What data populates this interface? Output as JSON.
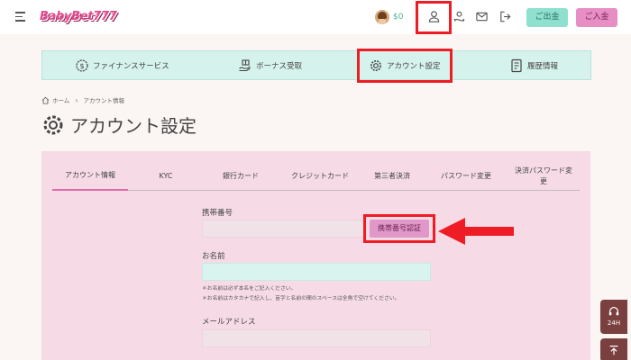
{
  "header": {
    "logo_text": "BabyBet777",
    "balance": "$0",
    "withdraw_label": "ご出金",
    "deposit_label": "ご入金"
  },
  "nav": {
    "items": [
      {
        "label": "ファイナンスサービス",
        "icon": "dollar-gear-icon"
      },
      {
        "label": "ボーナス受取",
        "icon": "gift-hand-icon"
      },
      {
        "label": "アカウント設定",
        "icon": "gear-icon"
      },
      {
        "label": "履歴情報",
        "icon": "document-icon"
      }
    ]
  },
  "breadcrumb": {
    "home": "ホーム",
    "current": "アカウント情報"
  },
  "page": {
    "title": "アカウント設定"
  },
  "tabs": [
    {
      "label": "アカウント情報",
      "active": true
    },
    {
      "label": "KYC"
    },
    {
      "label": "銀行カード"
    },
    {
      "label": "クレジットカード"
    },
    {
      "label": "第三者決済"
    },
    {
      "label": "パスワード変更"
    },
    {
      "label": "決済パスワード変更"
    }
  ],
  "form": {
    "phone_label": "携帯番号",
    "phone_value": "",
    "phone_verify_button": "携帯番号認証",
    "name_label": "お名前",
    "name_value": "",
    "name_note_1": "＊お名前は必ず本名をご記入ください。",
    "name_note_2": "＊お名前はカタカナで記入し、苗字と名前の間のスペースは全角で空けてください。",
    "email_label": "メールアドレス",
    "email_value": ""
  },
  "support": {
    "label": "24H"
  },
  "colors": {
    "accent_pink": "#e78fc4",
    "accent_mint": "#8fe0cf",
    "highlight_red": "#ee1c24",
    "panel_bg": "#f6dbe6"
  }
}
